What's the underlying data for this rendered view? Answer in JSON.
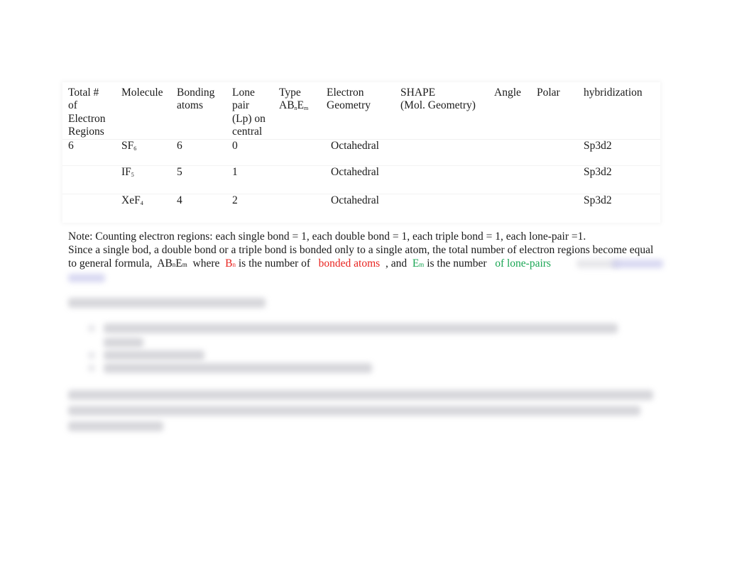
{
  "table": {
    "headers": [
      "Total # of Electron Regions",
      "Molecule",
      "Bonding atoms",
      "Lone pair (Lp) on central",
      "Type",
      "Electron Geometry",
      "SHAPE (Mol. Geometry)",
      "Angle",
      "Polar",
      "hybridization"
    ],
    "header_lines": {
      "total": [
        "Total #",
        "of",
        "Electron",
        "Regions"
      ],
      "bonding": [
        "Bonding",
        "atoms"
      ],
      "lone": [
        "Lone",
        "pair",
        "(Lp) on",
        "central"
      ],
      "type_label": "Type",
      "type_formula": {
        "a": "AB",
        "n": "n",
        "e": "E",
        "m": "m"
      },
      "egeo": [
        "Electron",
        "Geometry"
      ],
      "shape": [
        "SHAPE",
        "(Mol. Geometry)"
      ],
      "angle": "Angle",
      "polar": "Polar",
      "hyb": "hybridization"
    },
    "rows": [
      {
        "total": "6",
        "mol_base": "SF",
        "mol_sub": "6",
        "bonding": "6",
        "lone": "0",
        "type": "",
        "egeo": "Octahedral",
        "shape": "",
        "angle": "",
        "polar": "",
        "hyb": "Sp3d2"
      },
      {
        "total": "",
        "mol_base": "IF",
        "mol_sub": "5",
        "bonding": "5",
        "lone": "1",
        "type": "",
        "egeo": "Octahedral",
        "shape": "",
        "angle": "",
        "polar": "",
        "hyb": "Sp3d2"
      },
      {
        "total": "",
        "mol_base": "XeF",
        "mol_sub": "4",
        "bonding": "4",
        "lone": "2",
        "type": "",
        "egeo": "Octahedral",
        "shape": "",
        "angle": "",
        "polar": "",
        "hyb": "Sp3d2"
      }
    ]
  },
  "note": {
    "line1": "Note:  Counting electron regions:  each single bond = 1, each double bond = 1, each triple bond = 1, each lone-pair =1.",
    "line2": "Since a single bod, a double  bond or a triple  bond is bonded only to a single atom, the total number of electron regions become equal",
    "line3_a": "to general formula,  AB",
    "line3_n": "n",
    "line3_e": "E",
    "line3_m": "m",
    "line3_b": "  where  ",
    "line3_bn": "B",
    "line3_bn_sub": "n",
    "line3_c": " is the number of  ",
    "line3_red": " bonded atoms ",
    "line3_d": " , and  ",
    "line3_em": "E",
    "line3_em_sub": "m",
    "line3_e2": " is the number  ",
    "line3_green": " of lone-pairs",
    "colors": {
      "red": "#e8231f",
      "green": "#1aa654"
    }
  }
}
